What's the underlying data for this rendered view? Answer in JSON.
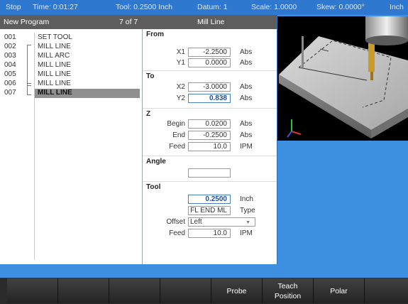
{
  "status_bar": {
    "mode": "Stop",
    "time": "Time: 0:01:27",
    "tool": "Tool: 0.2500 Inch",
    "datum": "Datum: 1",
    "scale": "Scale: 1.0000",
    "skew": "Skew: 0.0000°",
    "units": "Inch"
  },
  "title_bar": {
    "program_name": "New Program",
    "position": "7 of 7",
    "step_title": "Mill Line"
  },
  "program_steps": [
    {
      "num": "001",
      "cmd": "SET TOOL"
    },
    {
      "num": "002",
      "cmd": "MILL LINE"
    },
    {
      "num": "003",
      "cmd": "MILL ARC"
    },
    {
      "num": "004",
      "cmd": "MILL LINE"
    },
    {
      "num": "005",
      "cmd": "MILL LINE"
    },
    {
      "num": "006",
      "cmd": "MILL LINE"
    },
    {
      "num": "007",
      "cmd": "MILL LINE"
    }
  ],
  "form": {
    "from": {
      "header": "From",
      "x1_label": "X1",
      "x1_value": "-2.2500",
      "x1_unit": "Abs",
      "y1_label": "Y1",
      "y1_value": "0.0000",
      "y1_unit": "Abs"
    },
    "to": {
      "header": "To",
      "x2_label": "X2",
      "x2_value": "-3.0000",
      "x2_unit": "Abs",
      "y2_label": "Y2",
      "y2_value": "0.838",
      "y2_unit": "Abs"
    },
    "z": {
      "header": "Z",
      "begin_label": "Begin",
      "begin_value": "0.0200",
      "begin_unit": "Abs",
      "end_label": "End",
      "end_value": "-0.2500",
      "end_unit": "Abs",
      "feed_label": "Feed",
      "feed_value": "10.0",
      "feed_unit": "IPM"
    },
    "angle": {
      "header": "Angle",
      "value": ""
    },
    "tool": {
      "header": "Tool",
      "diameter_value": "0.2500",
      "diameter_unit": "Inch",
      "type_value": "FL END ML",
      "type_unit": "Type",
      "offset_label": "Offset",
      "offset_value": "Left",
      "feed_label": "Feed",
      "feed_value": "10.0",
      "feed_unit": "IPM"
    }
  },
  "softkeys": [
    "",
    "",
    "",
    "",
    "Probe",
    "Teach\nPosition",
    "Polar",
    ""
  ],
  "colors": {
    "background": "#3d8fe0",
    "status_bar": "#2f78cf",
    "title_bar": "#5d5d5d",
    "selected_row": "#8f8f8f",
    "tool_gold": "#c89a2a"
  }
}
